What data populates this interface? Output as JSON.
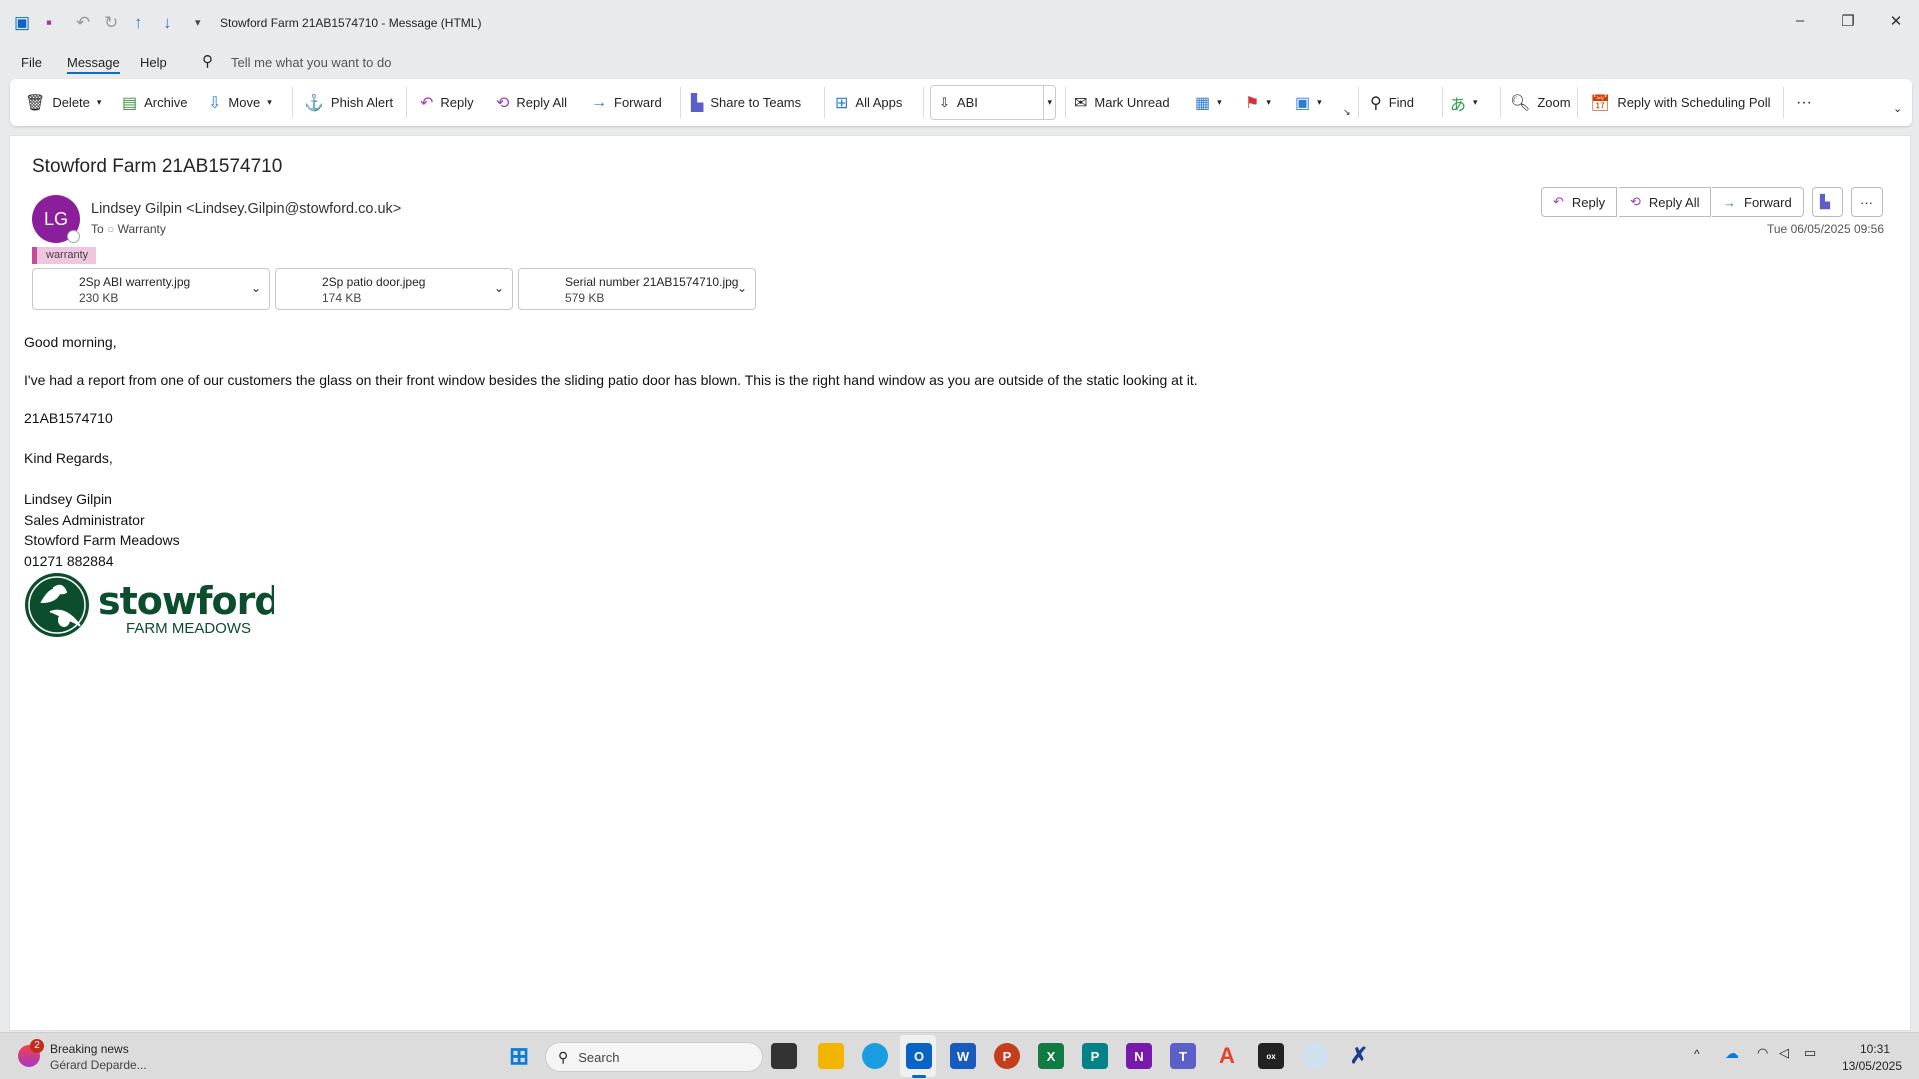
{
  "window": {
    "title": "Stowford Farm 21AB1574710  -  Message (HTML)"
  },
  "menu": {
    "file": "File",
    "message": "Message",
    "help": "Help",
    "tell_me": "Tell me what you want to do"
  },
  "toolbar": {
    "delete": "Delete",
    "archive": "Archive",
    "move": "Move",
    "phish": "Phish Alert",
    "reply": "Reply",
    "reply_all": "Reply All",
    "forward": "Forward",
    "teams": "Share to Teams",
    "all_apps": "All Apps",
    "quick_step": "ABI",
    "mark_unread": "Mark Unread",
    "find": "Find",
    "zoom": "Zoom",
    "poll": "Reply with Scheduling Poll"
  },
  "message": {
    "subject": "Stowford Farm 21AB1574710",
    "avatar_initials": "LG",
    "avatar_color": "#8b1e9a",
    "sender": "Lindsey Gilpin <Lindsey.Gilpin@stowford.co.uk>",
    "to_label": "To",
    "to": "Warranty",
    "category": "warranty",
    "date": "Tue 06/05/2025 09:56",
    "actions": {
      "reply": "Reply",
      "reply_all": "Reply All",
      "forward": "Forward"
    },
    "attachments": [
      {
        "name": "2Sp ABI warrenty.jpg",
        "size": "230 KB"
      },
      {
        "name": "2Sp patio door.jpeg",
        "size": "174 KB"
      },
      {
        "name": "Serial number 21AB1574710.jpg",
        "size": "579 KB"
      }
    ],
    "body": [
      "Good morning,",
      "I've had a report from one of our customers the glass on their front window besides the sliding patio door has blown. This is the right hand window as you are outside of the static looking at it.",
      "21AB1574710",
      "Kind Regards,",
      "Lindsey Gilpin",
      "Sales Administrator",
      "Stowford Farm Meadows",
      "01271 882884"
    ],
    "logo": {
      "word": "stowford",
      "sub": "FARM MEADOWS",
      "color": "#0b4d2c"
    }
  },
  "taskbar": {
    "news_title": "Breaking news",
    "news_sub": "Gérard Deparde...",
    "news_badge": "2",
    "search": "Search",
    "time": "10:31",
    "date": "13/05/2025"
  }
}
